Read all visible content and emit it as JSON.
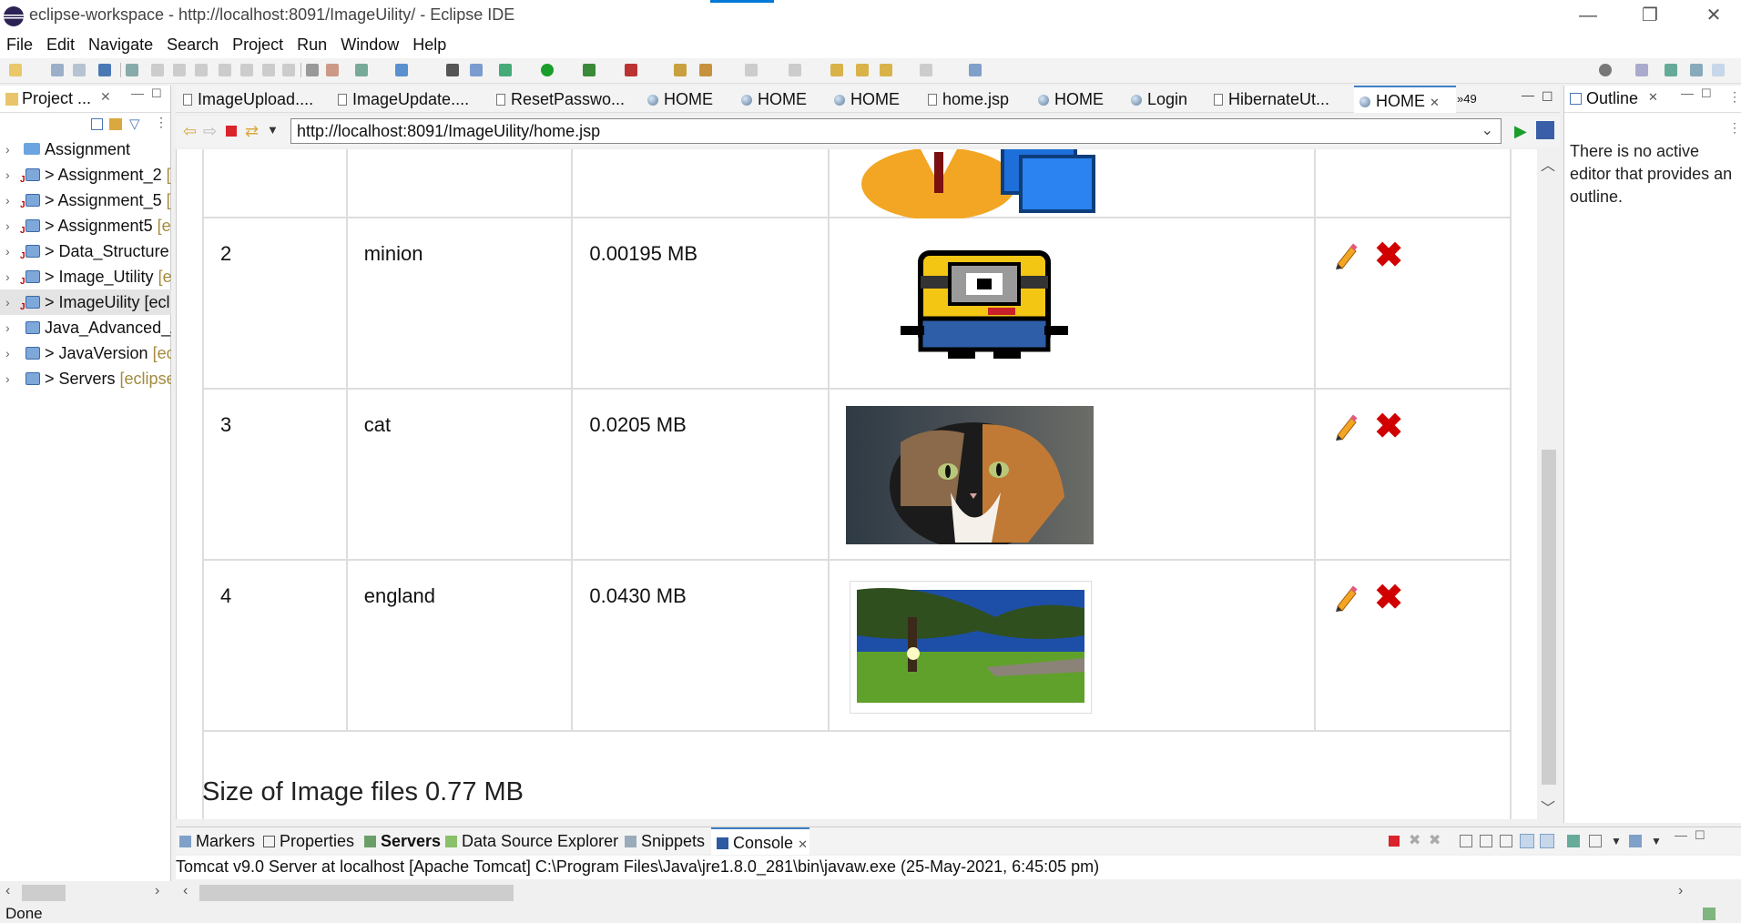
{
  "window": {
    "title": "eclipse-workspace - http://localhost:8091/ImageUility/ - Eclipse IDE",
    "minimize": "—",
    "restore": "❐",
    "close": "✕"
  },
  "menu": [
    "File",
    "Edit",
    "Navigate",
    "Search",
    "Project",
    "Run",
    "Window",
    "Help"
  ],
  "left_pane": {
    "title": "Project ...",
    "items": [
      {
        "label": "Assignment",
        "deco": "",
        "type": "folder"
      },
      {
        "label": "> Assignment_2",
        "deco": "[",
        "type": "project"
      },
      {
        "label": "> Assignment_5",
        "deco": "[",
        "type": "project"
      },
      {
        "label": "> Assignment5",
        "deco": "[e",
        "type": "project"
      },
      {
        "label": "> Data_Structure",
        "deco": "[",
        "type": "project"
      },
      {
        "label": "> Image_Utility",
        "deco": "[e",
        "type": "project"
      },
      {
        "label": "> ImageUility [ecl",
        "deco": "",
        "type": "project"
      },
      {
        "label": "Java_Advanced_A",
        "deco": "",
        "type": "project"
      },
      {
        "label": "> JavaVersion",
        "deco": "[ecl",
        "type": "project"
      },
      {
        "label": "> Servers",
        "deco": "[eclipse",
        "type": "project"
      }
    ]
  },
  "editor_tabs": [
    {
      "label": "ImageUpload....",
      "icon": "file"
    },
    {
      "label": "ImageUpdate....",
      "icon": "file"
    },
    {
      "label": "ResetPasswo...",
      "icon": "file"
    },
    {
      "label": "HOME",
      "icon": "globe"
    },
    {
      "label": "HOME",
      "icon": "globe"
    },
    {
      "label": "HOME",
      "icon": "globe"
    },
    {
      "label": "home.jsp",
      "icon": "file"
    },
    {
      "label": "HOME",
      "icon": "globe"
    },
    {
      "label": "Login",
      "icon": "globe"
    },
    {
      "label": "HibernateUt...",
      "icon": "file"
    },
    {
      "label": "HOME",
      "icon": "globe",
      "active": true,
      "close": "✕"
    }
  ],
  "overflow_count": "»49",
  "url": "http://localhost:8091/ImageUility/home.jsp",
  "table": {
    "rows": [
      {
        "id": "",
        "name": "",
        "size": "",
        "image": "user-computer-icon",
        "actions": false
      },
      {
        "id": "2",
        "name": "minion",
        "size": "0.00195 MB",
        "image": "minion-pixel-image",
        "actions": true
      },
      {
        "id": "3",
        "name": "cat",
        "size": "0.0205 MB",
        "image": "cat-photo",
        "actions": true
      },
      {
        "id": "4",
        "name": "england",
        "size": "0.0430 MB",
        "image": "england-tree-photo",
        "actions": true
      }
    ],
    "edit_icon": "pencil-icon",
    "delete_icon": "red-x-icon"
  },
  "summary": "Size of Image files 0.77 MB",
  "outline": {
    "title": "Outline",
    "message": "There is no active editor that provides an outline."
  },
  "bottom_tabs": [
    {
      "label": "Markers"
    },
    {
      "label": "Properties"
    },
    {
      "label": "Servers",
      "bold": true
    },
    {
      "label": "Data Source Explorer"
    },
    {
      "label": "Snippets"
    },
    {
      "label": "Console",
      "active": true,
      "close": "✕"
    }
  ],
  "console": "Tomcat v9.0 Server at localhost [Apache Tomcat] C:\\Program Files\\Java\\jre1.8.0_281\\bin\\javaw.exe  (25-May-2021, 6:45:05 pm)",
  "status": "Done",
  "colors": {
    "accent": "#3f7fc4",
    "delete": "#d10000",
    "pencil": "#f2a623"
  }
}
